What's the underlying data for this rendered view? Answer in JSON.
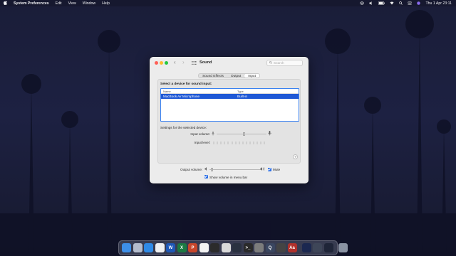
{
  "menubar": {
    "apple": "",
    "app_name": "System Preferences",
    "menus": [
      "Edit",
      "View",
      "Window",
      "Help"
    ],
    "clock": "Thu 1 Apr  23:11"
  },
  "window": {
    "title": "Sound",
    "search_placeholder": "Search",
    "tabs": [
      {
        "label": "Sound Effects",
        "active": false
      },
      {
        "label": "Output",
        "active": false
      },
      {
        "label": "Input",
        "active": true
      }
    ],
    "section_title": "Select a device for sound input:",
    "table": {
      "headers": [
        "Name",
        "Type"
      ],
      "rows": [
        {
          "name": "MacBook Air Microphone",
          "type": "Built-in",
          "selected": true
        }
      ]
    },
    "settings_label": "Settings for the selected device:",
    "input_volume_label": "Input volume:",
    "input_volume_level": 0.55,
    "input_level_label": "Input level:",
    "input_level_bars": 15,
    "help": "?",
    "output_volume_label": "Output volume:",
    "output_volume_level": 0.05,
    "mute_label": "Mute",
    "mute_checked": true,
    "menubar_label": "Show volume in menu bar",
    "menubar_checked": true
  },
  "colors": {
    "accent": "#1f59d6",
    "selection_border": "#3a81f0",
    "close": "#fe5f57",
    "minimize": "#febc2e",
    "zoom": "#28c840"
  },
  "dock": {
    "apps": [
      {
        "icon": "finder-icon",
        "glyph": "",
        "bg": "#3d8fe8"
      },
      {
        "icon": "launchpad-icon",
        "glyph": "",
        "bg": "#b4bccc"
      },
      {
        "icon": "safari-icon",
        "glyph": "",
        "bg": "#2f8ae6"
      },
      {
        "icon": "brave-icon",
        "glyph": "",
        "bg": "#f0f0f0"
      },
      {
        "icon": "word-icon",
        "glyph": "W",
        "bg": "#1f58b6"
      },
      {
        "icon": "excel-icon",
        "glyph": "X",
        "bg": "#1c7a43"
      },
      {
        "icon": "powerpoint-icon",
        "glyph": "P",
        "bg": "#c8462b"
      },
      {
        "icon": "chrome-icon",
        "glyph": "",
        "bg": "#f2f2f2"
      },
      {
        "icon": "activity-monitor-icon",
        "glyph": "",
        "bg": "#2b2b2b"
      },
      {
        "icon": "glasses-icon",
        "glyph": "",
        "bg": "#d9d9d9"
      },
      {
        "icon": "hardware-monitor-icon",
        "glyph": "",
        "bg": "#2a3140"
      },
      {
        "icon": "terminal-icon",
        "glyph": ">_",
        "bg": "#2a2a2a"
      },
      {
        "icon": "system-preferences-icon",
        "glyph": "",
        "bg": "#7c7c7c"
      },
      {
        "icon": "quicktime-icon",
        "glyph": "Q",
        "bg": "#3a4660"
      },
      {
        "icon": "calculator-icon",
        "glyph": "",
        "bg": "#444"
      },
      {
        "icon": "dictionary-icon",
        "glyph": "Aa",
        "bg": "#b0312c"
      },
      {
        "icon": "window-thumb-1-icon",
        "glyph": "",
        "bg": "#1b2850"
      },
      {
        "icon": "window-thumb-2-icon",
        "glyph": "",
        "bg": "#3e4658"
      },
      {
        "icon": "window-thumb-3-icon",
        "glyph": "",
        "bg": "#1f2538"
      },
      {
        "icon": "trash-icon",
        "glyph": "",
        "bg": "#8a93a3"
      }
    ]
  }
}
